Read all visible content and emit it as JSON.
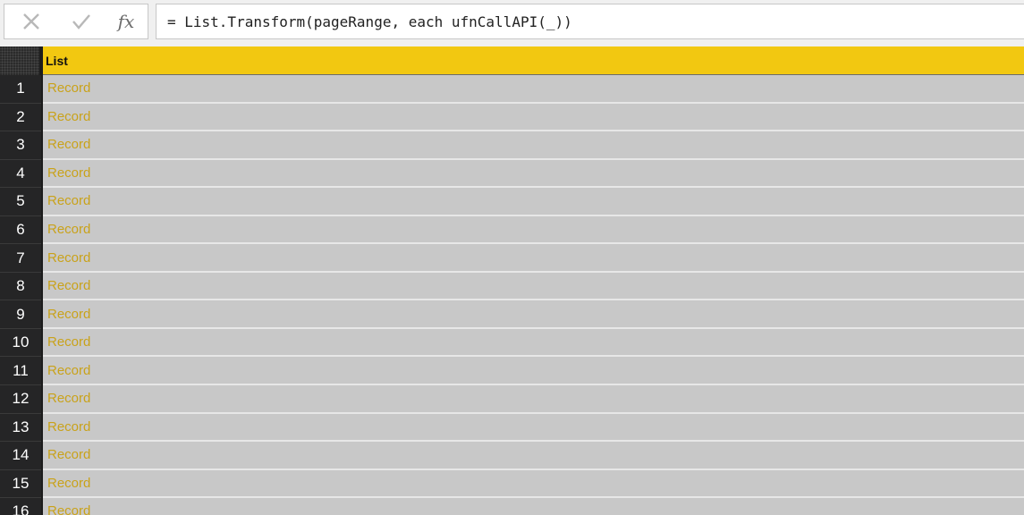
{
  "formula_bar": {
    "cancel_icon": "close-icon",
    "commit_icon": "check-icon",
    "fx_label": "fx",
    "formula": "= List.Transform(pageRange, each ufnCallAPI(_))"
  },
  "table": {
    "column_header": "List",
    "rows": [
      {
        "number": "1",
        "value": "Record"
      },
      {
        "number": "2",
        "value": "Record"
      },
      {
        "number": "3",
        "value": "Record"
      },
      {
        "number": "4",
        "value": "Record"
      },
      {
        "number": "5",
        "value": "Record"
      },
      {
        "number": "6",
        "value": "Record"
      },
      {
        "number": "7",
        "value": "Record"
      },
      {
        "number": "8",
        "value": "Record"
      },
      {
        "number": "9",
        "value": "Record"
      },
      {
        "number": "10",
        "value": "Record"
      },
      {
        "number": "11",
        "value": "Record"
      },
      {
        "number": "12",
        "value": "Record"
      },
      {
        "number": "13",
        "value": "Record"
      },
      {
        "number": "14",
        "value": "Record"
      },
      {
        "number": "15",
        "value": "Record"
      },
      {
        "number": "16",
        "value": "Record"
      }
    ]
  },
  "colors": {
    "header_background": "#f2c811",
    "record_link": "#c9a21a",
    "row_number_background": "#252526",
    "cell_background": "#c8c8c8"
  }
}
